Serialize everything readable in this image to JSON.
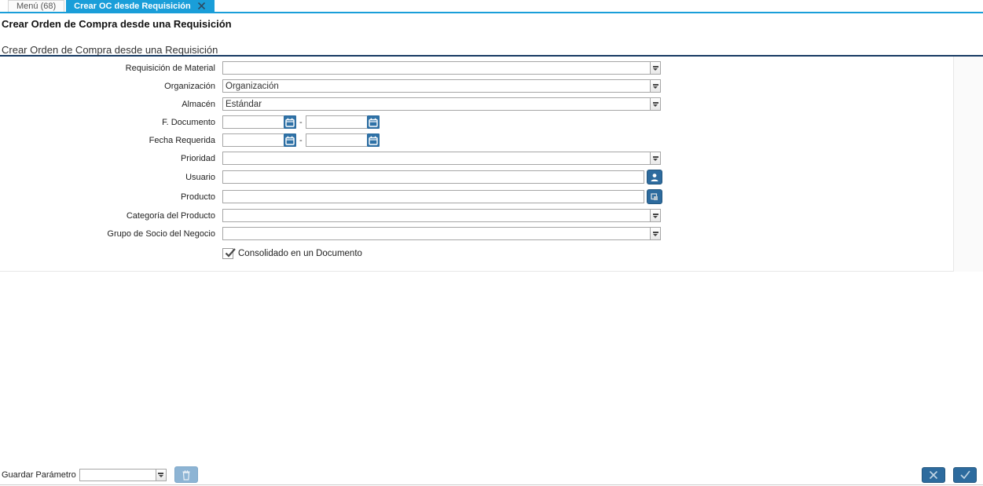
{
  "tabs": {
    "menu": {
      "label": "Menú (68)"
    },
    "active": {
      "label": "Crear OC desde Requisición"
    }
  },
  "window_title": "Crear Orden de Compra desde una Requisición",
  "process_title": "Crear Orden de Compra desde una Requisición",
  "form": {
    "date_separator": "-",
    "fields": [
      {
        "label": "Requisición de Material",
        "type": "combo",
        "value": ""
      },
      {
        "label": "Organización",
        "type": "combo",
        "value": "Organización"
      },
      {
        "label": "Almacén",
        "type": "combo",
        "value": "Estándar"
      },
      {
        "label": "F. Documento",
        "type": "daterange",
        "from": "",
        "to": ""
      },
      {
        "label": "Fecha Requerida",
        "type": "daterange",
        "from": "",
        "to": ""
      },
      {
        "label": "Prioridad",
        "type": "combo",
        "value": ""
      },
      {
        "label": "Usuario",
        "type": "search",
        "value": "",
        "icon": "user-icon"
      },
      {
        "label": "Producto",
        "type": "search",
        "value": "",
        "icon": "product-icon"
      },
      {
        "label": "Categoría del Producto",
        "type": "combo",
        "value": ""
      },
      {
        "label": "Grupo de Socio del Negocio",
        "type": "combo",
        "value": ""
      }
    ],
    "checkbox": {
      "label": "Consolidado en un Documento",
      "checked": true
    }
  },
  "footer": {
    "save_parameter_label": "Guardar Parámetro",
    "save_parameter_value": "",
    "delete_button_icon": "trash-icon",
    "cancel_button_icon": "x-icon",
    "ok_button_icon": "check-icon"
  },
  "colors": {
    "accent_blue": "#1a9ed9",
    "button_blue": "#2d6b9e",
    "navy_line": "#173a63"
  }
}
